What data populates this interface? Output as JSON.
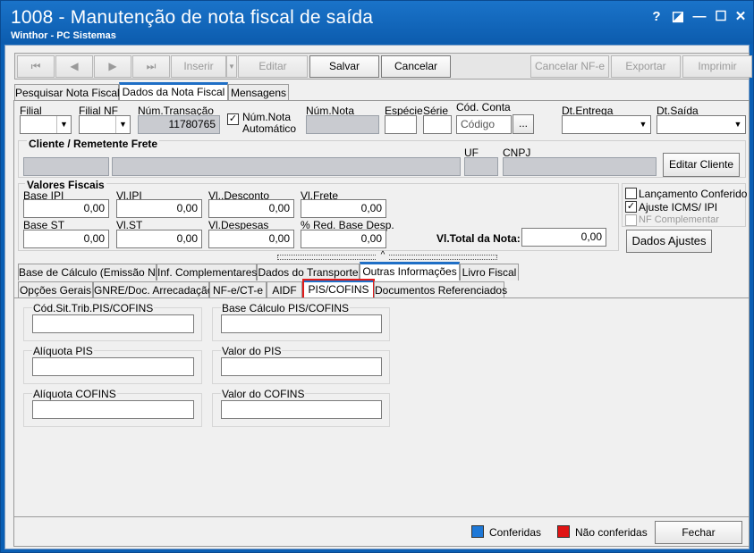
{
  "window": {
    "title": "1008 - Manutenção de nota fiscal de saída",
    "subtitle": "Winthor - PC Sistemas",
    "controls": {
      "help": "?",
      "restore": "◪",
      "minimize": "—",
      "maximize": "☐",
      "close": "✕"
    }
  },
  "toolbar": {
    "first": "⏮",
    "prev": "◀",
    "next": "▶",
    "last": "⏭",
    "insert": "Inserir",
    "edit": "Editar",
    "save": "Salvar",
    "cancel": "Cancelar",
    "cancel_nfe": "Cancelar NF-e",
    "export": "Exportar",
    "print": "Imprimir"
  },
  "top_tabs": [
    "Pesquisar Nota Fiscal",
    "Dados da Nota Fiscal",
    "Mensagens"
  ],
  "header": {
    "filial_label": "Filial",
    "filial_nf_label": "Filial NF",
    "num_transacao_label": "Núm.Transação",
    "num_transacao_value": "11780765",
    "num_nota_auto_label_1": "Núm.Nota",
    "num_nota_auto_label_2": "Automático",
    "num_nota_label": "Núm.Nota",
    "especie_label": "Espécie",
    "serie_label": "Série",
    "cod_conta_label": "Cód. Conta",
    "cod_conta_placeholder": "Código",
    "ellipsis": "...",
    "dt_entrega_label": "Dt.Entrega",
    "dt_saida_label": "Dt.Saída"
  },
  "cliente": {
    "title": "Cliente / Remetente Frete",
    "uf_label": "UF",
    "cnpj_label": "CNPJ",
    "edit_button": "Editar Cliente"
  },
  "valores": {
    "title": "Valores Fiscais",
    "base_ipi_label": "Base IPI",
    "base_ipi": "0,00",
    "vl_ipi_label": "Vl.IPI",
    "vl_ipi": "0,00",
    "vl_desconto_label": "Vl..Desconto",
    "vl_desconto": "0,00",
    "vl_frete_label": "Vl.Frete",
    "vl_frete": "0,00",
    "base_st_label": "Base ST",
    "base_st": "0,00",
    "vl_st_label": "Vl.ST",
    "vl_st": "0,00",
    "vl_despesas_label": "Vl.Despesas",
    "vl_despesas": "0,00",
    "red_base_label": "% Red. Base Desp.",
    "red_base": "0,00",
    "vl_total_label": "Vl.Total da Nota:",
    "vl_total": "0,00"
  },
  "checks": {
    "lancamento": "Lançamento Conferido",
    "ajuste": "Ajuste ICMS/ IPI",
    "nf_compl": "NF Complementar",
    "dados_ajustes": "Dados Ajustes"
  },
  "middle_tabs": [
    "Base de Cálculo (Emissão NF)",
    "Inf. Complementares",
    "Dados do Transporte",
    "Outras Informações",
    "Livro Fiscal"
  ],
  "sub_tabs": [
    "Opções Gerais",
    "GNRE/Doc. Arrecadação",
    "NF-e/CT-e",
    "AIDF",
    "PIS/COFINS",
    "Documentos Referenciados"
  ],
  "pis_cofins": {
    "cst_label": "Cód.Sit.Trib.PIS/COFINS",
    "base_label": "Base Cálculo PIS/COFINS",
    "aliq_pis_label": "Alíquota PIS",
    "valor_pis_label": "Valor do PIS",
    "aliq_cofins_label": "Alíquota COFINS",
    "valor_cofins_label": "Valor do COFINS"
  },
  "footer": {
    "conferidas": "Conferidas",
    "nao_conferidas": "Não conferidas",
    "fechar": "Fechar",
    "color_conferidas": "#1e78d7",
    "color_nao_conferidas": "#e01414"
  }
}
